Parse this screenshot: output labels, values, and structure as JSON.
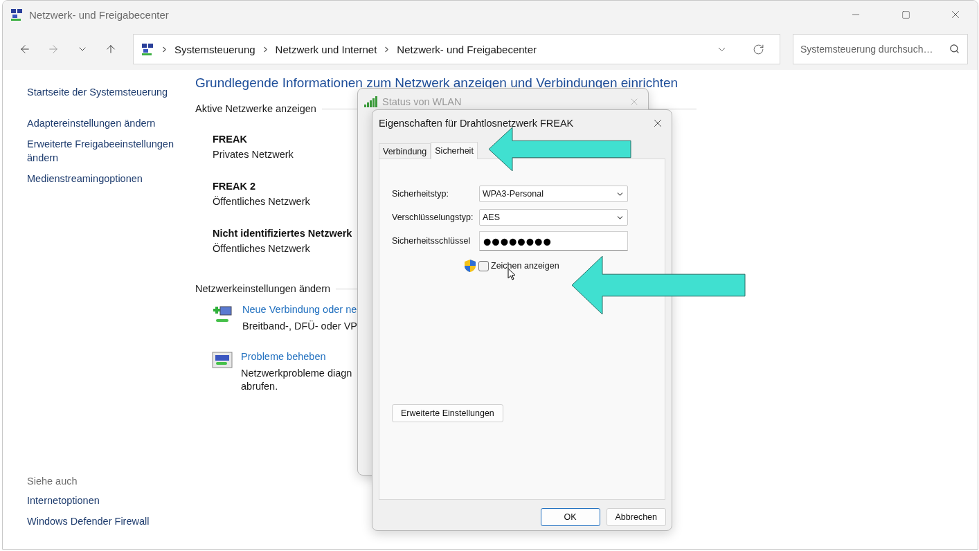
{
  "window": {
    "title": "Netzwerk- und Freigabecenter"
  },
  "address_bar": {
    "breadcrumbs": [
      "Systemsteuerung",
      "Netzwerk und Internet",
      "Netzwerk- und Freigabecenter"
    ]
  },
  "search": {
    "placeholder": "Systemsteuerung durchsuch…"
  },
  "sidebar": {
    "links": [
      "Startseite der Systemsteuerung",
      "Adaptereinstellungen ändern",
      "Erweiterte Freigabeeinstellungen ändern",
      "Medienstreamingoptionen"
    ],
    "see_also_heading": "Siehe auch",
    "see_also": [
      "Internetoptionen",
      "Windows Defender Firewall"
    ]
  },
  "main": {
    "heading": "Grundlegende Informationen zum Netzwerk anzeigen und Verbindungen einrichten",
    "active_networks": {
      "heading": "Aktive Netzwerke anzeigen",
      "networks": [
        {
          "name": "FREAK",
          "type": "Privates Netzwerk"
        },
        {
          "name": "FREAK 2",
          "type": "Öffentliches Netzwerk"
        },
        {
          "name": "Nicht identifiziertes Netzwerk",
          "type": "Öffentliches Netzwerk"
        }
      ]
    },
    "settings": {
      "heading": "Netzwerkeinstellungen ändern",
      "tasks": [
        {
          "kind": "new-connection",
          "link": "Neue Verbindung oder ne",
          "description": [
            "Breitband-, DFÜ- oder VP"
          ]
        },
        {
          "kind": "troubleshoot",
          "link": "Probleme beheben",
          "description": [
            "Netzwerkprobleme diagn",
            "abrufen."
          ]
        }
      ]
    }
  },
  "status_dialog": {
    "title": "Status von WLAN"
  },
  "properties_dialog": {
    "title": "Eigenschaften für Drahtlosnetzwerk FREAK",
    "tabs": [
      {
        "label": "Verbindung",
        "selected": false
      },
      {
        "label": "Sicherheit",
        "selected": true
      }
    ],
    "fields": [
      {
        "kind": "select",
        "label": "Sicherheitstyp:",
        "value": "WPA3-Personal"
      },
      {
        "kind": "select",
        "label": "Verschlüsselungstyp:",
        "value": "AES"
      },
      {
        "kind": "password",
        "label": "Sicherheitsschlüssel",
        "value": "●●●●●●●●"
      }
    ],
    "show_characters": {
      "label": "Zeichen anzeigen",
      "checked": false
    },
    "advanced_button": "Erweiterte Einstellungen",
    "buttons": [
      {
        "label": "OK",
        "default": true
      },
      {
        "label": "Abbrechen",
        "default": false
      }
    ]
  }
}
